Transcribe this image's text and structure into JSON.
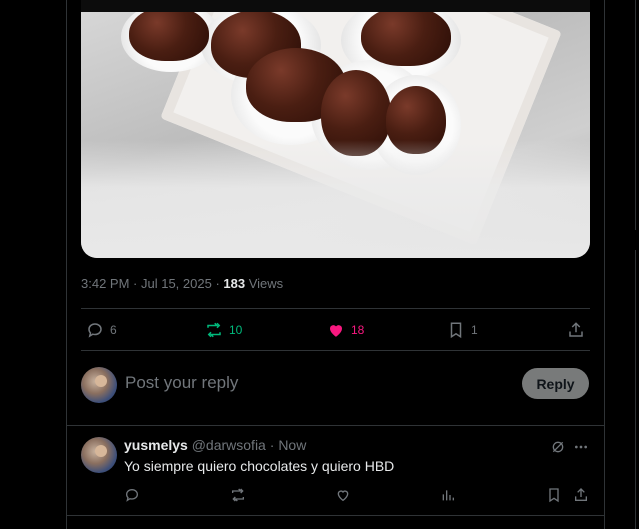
{
  "tweet": {
    "time": "3:42 PM",
    "date": "Jul 15, 2025",
    "views_count": "183",
    "views_label": "Views",
    "actions": {
      "replies": "6",
      "reposts": "10",
      "likes": "18",
      "bookmarks": "1"
    }
  },
  "composer": {
    "placeholder": "Post your reply",
    "reply_button": "Reply"
  },
  "comment": {
    "name": "yusmelys",
    "handle": "@darwsofia",
    "separator": "·",
    "time": "Now",
    "text": "Yo siempre quiero chocolates y quiero HBD"
  },
  "colors": {
    "background": "#000000",
    "border": "#2f3336",
    "muted": "#71767b",
    "repost_active": "#00ba7c",
    "like_active": "#f91880",
    "text": "#e7e9ea"
  }
}
